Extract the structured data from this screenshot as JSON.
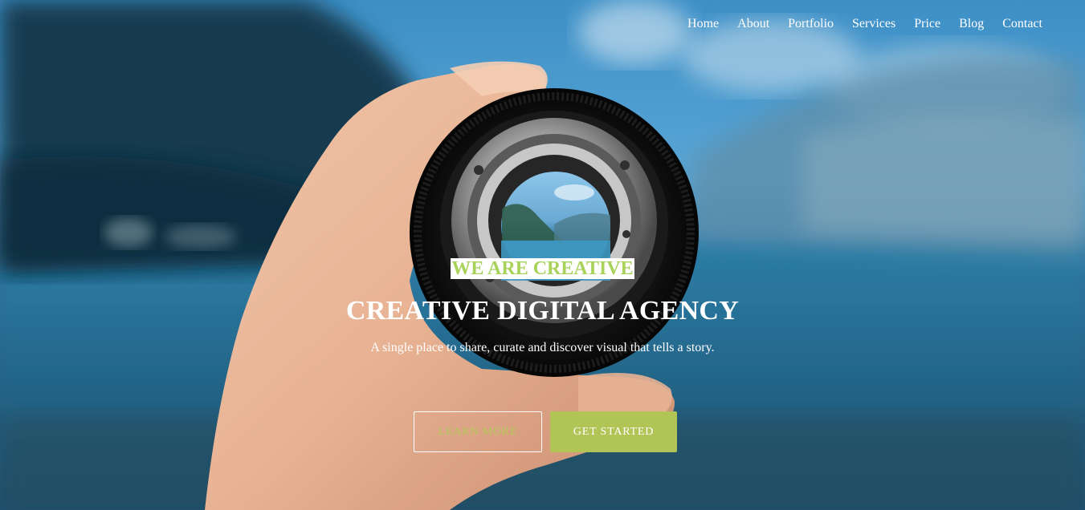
{
  "nav": {
    "items": [
      {
        "label": "Home"
      },
      {
        "label": "About"
      },
      {
        "label": "Portfolio"
      },
      {
        "label": "Services"
      },
      {
        "label": "Price"
      },
      {
        "label": "Blog"
      },
      {
        "label": "Contact"
      }
    ]
  },
  "hero": {
    "eyebrow": "WE ARE CREATIVE",
    "headline": "CREATIVE DIGITAL AGENCY",
    "subline": "A single place to share, curate and discover visual that tells a story.",
    "learn_more_label": "LEARN MORE",
    "get_started_label": "GET STARTED"
  },
  "colors": {
    "accent_green": "#a8d25a",
    "button_green": "#b1c456",
    "text_white": "#ffffff"
  }
}
